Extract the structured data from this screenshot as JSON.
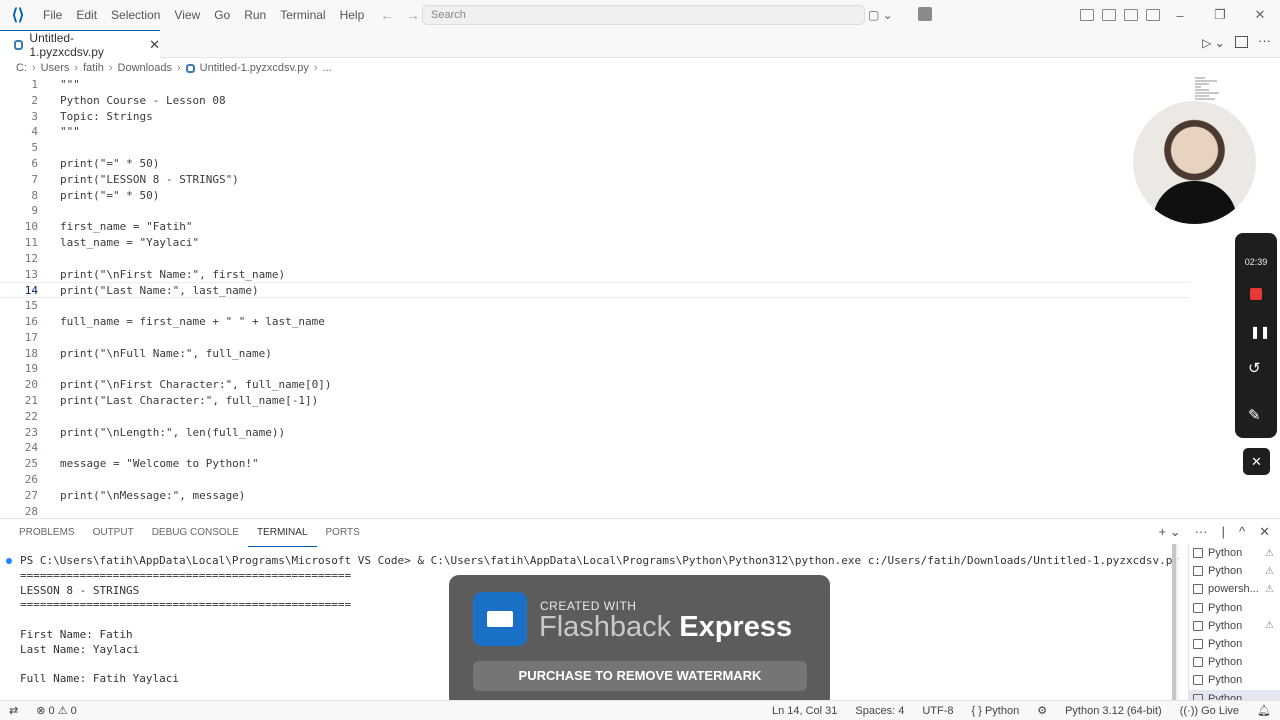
{
  "titlebar": {
    "menu": [
      "File",
      "Edit",
      "Selection",
      "View",
      "Go",
      "Run",
      "Terminal",
      "Help"
    ],
    "search_placeholder": "Search"
  },
  "tab": {
    "filename": "Untitled-1.pyzxcdsv.py"
  },
  "breadcrumb": [
    "C:",
    "Users",
    "fatih",
    "Downloads",
    "Untitled-1.pyzxcdsv.py",
    "..."
  ],
  "editor": {
    "current_line": 14,
    "lines": [
      {
        "n": "1",
        "text": "\"\"\""
      },
      {
        "n": "2",
        "text": "Python Course - Lesson 08"
      },
      {
        "n": "3",
        "text": "Topic: Strings"
      },
      {
        "n": "4",
        "text": "\"\"\""
      },
      {
        "n": "5",
        "text": ""
      },
      {
        "n": "6",
        "text": "print(\"=\" * 50)"
      },
      {
        "n": "7",
        "text": "print(\"LESSON 8 - STRINGS\")"
      },
      {
        "n": "8",
        "text": "print(\"=\" * 50)"
      },
      {
        "n": "9",
        "text": ""
      },
      {
        "n": "10",
        "text": "first_name = \"Fatih\""
      },
      {
        "n": "11",
        "text": "last_name = \"Yaylaci\""
      },
      {
        "n": "12",
        "text": ""
      },
      {
        "n": "13",
        "text": "print(\"\\nFirst Name:\", first_name)"
      },
      {
        "n": "14",
        "text": "print(\"Last Name:\", last_name)"
      },
      {
        "n": "15",
        "text": ""
      },
      {
        "n": "16",
        "text": "full_name = first_name + \" \" + last_name"
      },
      {
        "n": "17",
        "text": ""
      },
      {
        "n": "18",
        "text": "print(\"\\nFull Name:\", full_name)"
      },
      {
        "n": "19",
        "text": ""
      },
      {
        "n": "20",
        "text": "print(\"\\nFirst Character:\", full_name[0])"
      },
      {
        "n": "21",
        "text": "print(\"Last Character:\", full_name[-1])"
      },
      {
        "n": "22",
        "text": ""
      },
      {
        "n": "23",
        "text": "print(\"\\nLength:\", len(full_name))"
      },
      {
        "n": "24",
        "text": ""
      },
      {
        "n": "25",
        "text": "message = \"Welcome to Python!\""
      },
      {
        "n": "26",
        "text": ""
      },
      {
        "n": "27",
        "text": "print(\"\\nMessage:\", message)"
      },
      {
        "n": "28",
        "text": ""
      }
    ]
  },
  "recorder": {
    "time": "02:39"
  },
  "panel": {
    "tabs": [
      "PROBLEMS",
      "OUTPUT",
      "DEBUG CONSOLE",
      "TERMINAL",
      "PORTS"
    ],
    "active_tab": "TERMINAL"
  },
  "terminal": {
    "lines": [
      "PS C:\\Users\\fatih\\AppData\\Local\\Programs\\Microsoft VS Code> & C:\\Users\\fatih\\AppData\\Local\\Programs\\Python\\Python312\\python.exe c:/Users/fatih/Downloads/Untitled-1.pyzxcdsv.py",
      "==================================================",
      "LESSON 8 - STRINGS",
      "==================================================",
      "",
      "First Name: Fatih",
      "Last Name: Yaylaci",
      "",
      "Full Name: Fatih Yaylaci"
    ],
    "sessions": [
      "Python",
      "Python",
      "powersh...",
      "Python",
      "Python",
      "Python",
      "Python",
      "Python",
      "Python"
    ]
  },
  "watermark": {
    "created_with": "CREATED WITH",
    "brand_light": "Flashback",
    "brand_bold": "Express",
    "purchase": "PURCHASE TO REMOVE WATERMARK"
  },
  "statusbar": {
    "errors": "0",
    "warnings": "0",
    "position": "Ln 14, Col 31",
    "spaces": "Spaces: 4",
    "encoding": "UTF-8",
    "language": "{ } Python",
    "interpreter": "Python 3.12 (64-bit)",
    "golive": "Go Live"
  },
  "colors": {
    "accent": "#005fb8",
    "record_stop": "#e53935"
  }
}
